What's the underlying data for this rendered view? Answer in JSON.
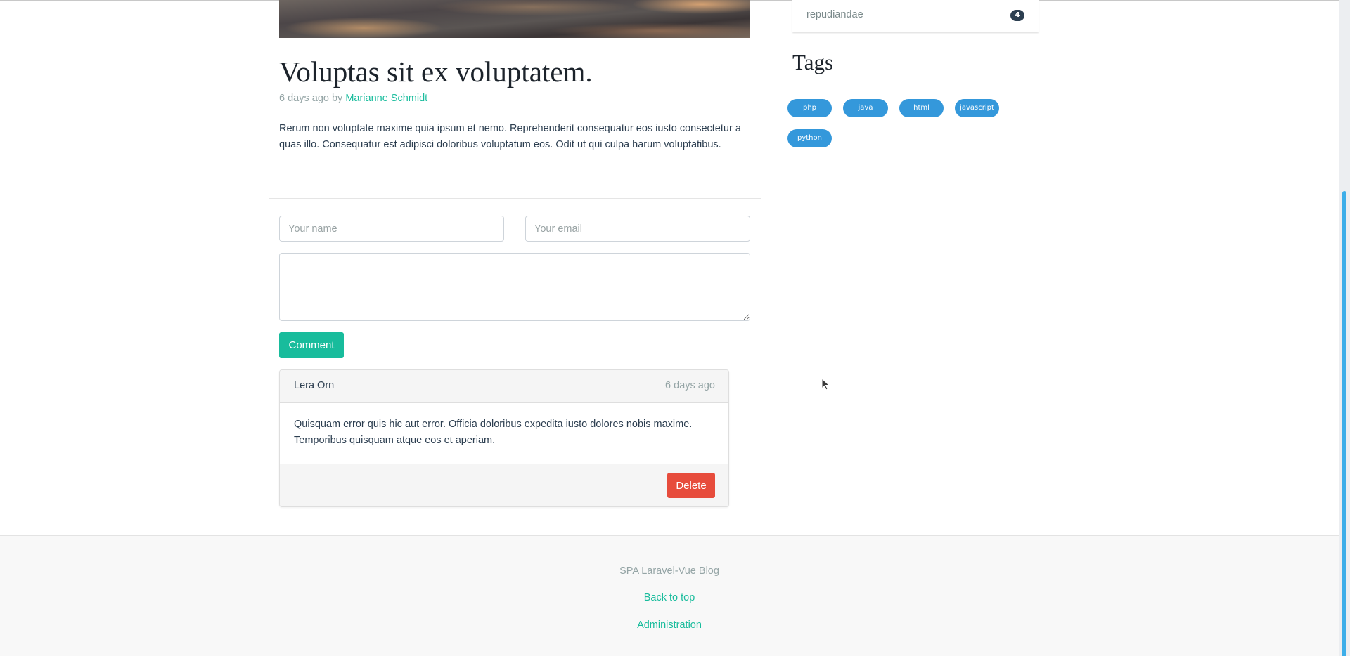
{
  "post": {
    "title": "Voluptas sit ex voluptatem.",
    "meta_prefix": "6 days ago by ",
    "author": "Marianne Schmidt",
    "body": "Rerum non voluptate maxime quia ipsum et nemo. Reprehenderit consequatur eos iusto consectetur a quas illo. Consequatur est adipisci doloribus voluptatum eos. Odit ut qui culpa harum voluptatibus."
  },
  "comment_form": {
    "name_placeholder": "Your name",
    "name_value": "",
    "email_placeholder": "Your email",
    "email_value": "",
    "message_value": "",
    "submit_label": "Comment"
  },
  "comments": [
    {
      "author": "Lera Orn",
      "time": "6 days ago",
      "body": "Quisquam error quis hic aut error. Officia doloribus expedita iusto dolores nobis maxime. Temporibus quisquam atque eos et aperiam.",
      "delete_label": "Delete"
    }
  ],
  "sidebar": {
    "categories": [
      {
        "name": "repudiandae",
        "count": "4"
      }
    ],
    "tags_title": "Tags",
    "tags": [
      "php",
      "java",
      "html",
      "javascript",
      "python"
    ]
  },
  "footer": {
    "brand": "SPA Laravel-Vue Blog",
    "back_to_top": "Back to top",
    "administration": "Administration"
  },
  "colors": {
    "accent": "#18bc9c",
    "danger": "#e74c3c",
    "tag": "#3498db",
    "badge": "#2c3e50",
    "scrollbar": "#3daee9"
  }
}
